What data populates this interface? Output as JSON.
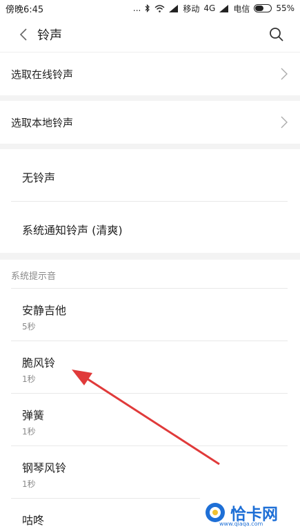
{
  "status_bar": {
    "time": "傍晚6:45",
    "dots": "...",
    "carrier1": "移动",
    "network": "4G",
    "carrier2": "电信",
    "battery": "55%",
    "battery_level": 0.55
  },
  "header": {
    "title": "铃声"
  },
  "online_ringtone": {
    "label": "选取在线铃声"
  },
  "local_ringtone": {
    "label": "选取本地铃声"
  },
  "options": [
    {
      "label": "无铃声"
    },
    {
      "label": "系统通知铃声 (清爽)"
    }
  ],
  "section": {
    "title": "系统提示音"
  },
  "sounds": [
    {
      "name": "安静吉他",
      "duration": "5秒"
    },
    {
      "name": "脆风铃",
      "duration": "1秒"
    },
    {
      "name": "弹簧",
      "duration": "1秒"
    },
    {
      "name": "钢琴风铃",
      "duration": "1秒"
    },
    {
      "name": "咕咚",
      "duration": ""
    }
  ],
  "watermark": {
    "brand": "恰卡网",
    "url": "www.qiaqa.com"
  },
  "colors": {
    "arrow": "#e03a3a",
    "watermark": "#1e6fd6"
  }
}
